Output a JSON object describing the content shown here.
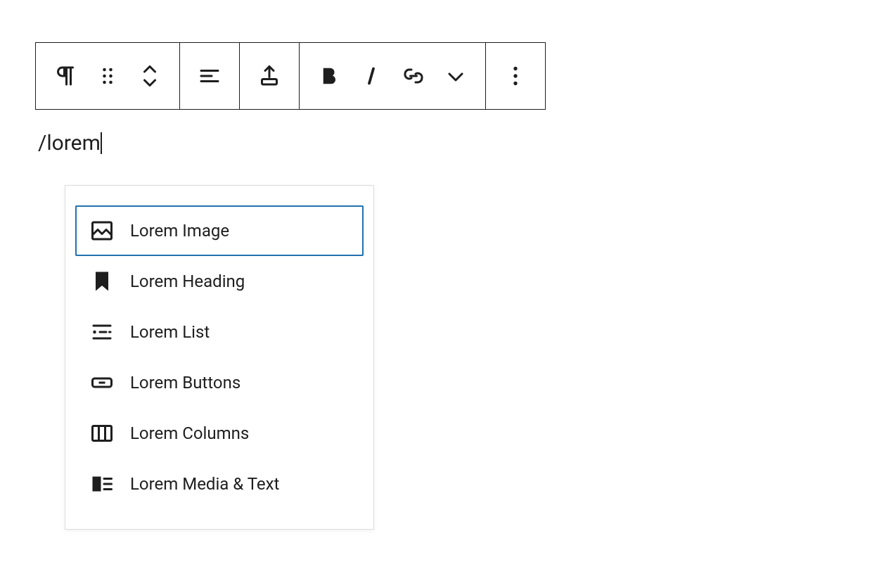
{
  "toolbar": {
    "groups": [
      {
        "items": [
          "paragraph",
          "drag",
          "move"
        ]
      },
      {
        "items": [
          "align"
        ]
      },
      {
        "items": [
          "insert"
        ]
      },
      {
        "items": [
          "bold",
          "italic",
          "link",
          "more-format"
        ]
      },
      {
        "items": [
          "options"
        ]
      }
    ]
  },
  "editor": {
    "slash_query": "/lorem"
  },
  "autocomplete": {
    "options": [
      {
        "icon": "image",
        "label": "Lorem Image",
        "selected": true
      },
      {
        "icon": "bookmark",
        "label": "Lorem Heading",
        "selected": false
      },
      {
        "icon": "list",
        "label": "Lorem List",
        "selected": false
      },
      {
        "icon": "button",
        "label": "Lorem Buttons",
        "selected": false
      },
      {
        "icon": "columns",
        "label": "Lorem Columns",
        "selected": false
      },
      {
        "icon": "media-text",
        "label": "Lorem Media & Text",
        "selected": false
      }
    ]
  }
}
